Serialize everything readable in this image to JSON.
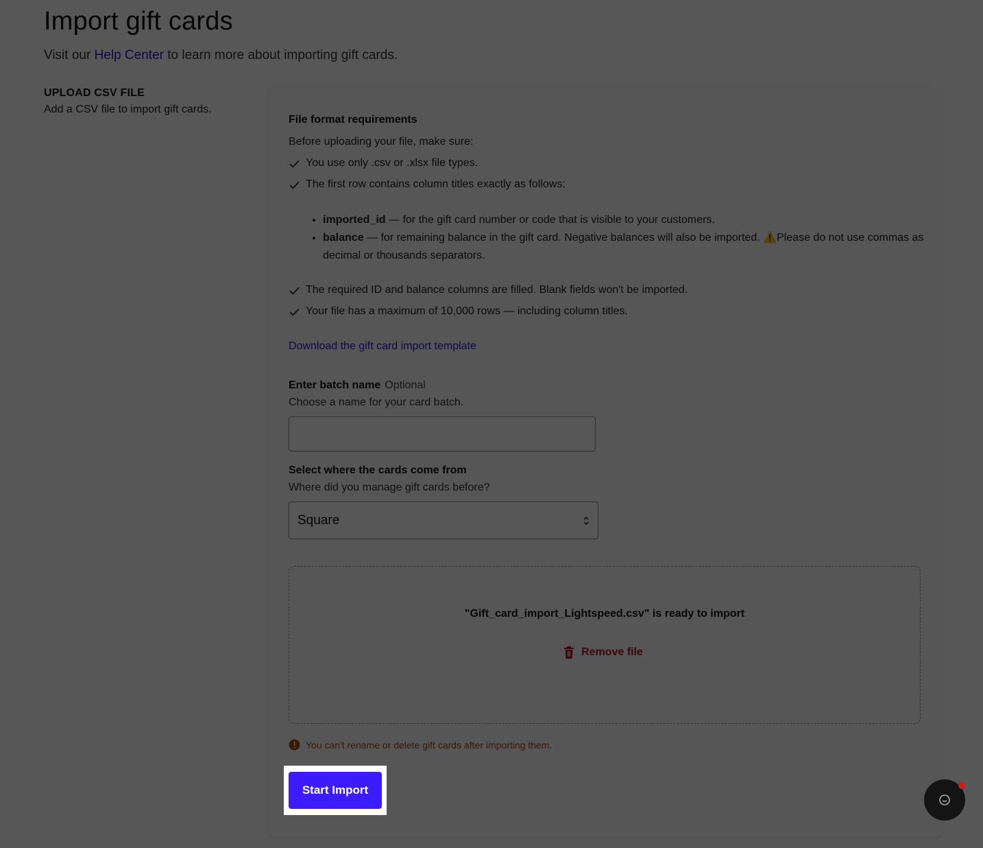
{
  "page": {
    "title": "Import gift cards",
    "subtitle_prefix": "Visit our ",
    "help_link": "Help Center",
    "subtitle_suffix": " to learn more about importing gift cards."
  },
  "section": {
    "title": "UPLOAD CSV FILE",
    "description": "Add a CSV file to import gift cards."
  },
  "requirements": {
    "title": "File format requirements",
    "intro": "Before uploading your file, make sure:",
    "checks_top": [
      "You use only .csv or .xlsx file types.",
      "The first row contains column titles exactly as follows:"
    ],
    "columns": [
      {
        "name": "imported_id",
        "desc": " — for the gift card number or code that is visible to your customers."
      },
      {
        "name": "balance",
        "desc": " — for remaining balance in the gift card. Negative balances will also be imported. ",
        "warning": "⚠️",
        "warning_text": "Please do not use commas as decimal or thousands separators."
      }
    ],
    "checks_bottom": [
      "The required ID and balance columns are filled. Blank fields won't be imported.",
      "Your file has a maximum of 10,000 rows — including column titles."
    ],
    "template_link": "Download the gift card import template"
  },
  "batch": {
    "label": "Enter batch name",
    "optional": "Optional",
    "help": "Choose a name for your card batch.",
    "value": ""
  },
  "source": {
    "label": "Select where the cards come from",
    "help": "Where did you manage gift cards before?",
    "selected": "Square"
  },
  "upload": {
    "ready_text": "\"Gift_card_import_Lightspeed.csv\" is ready to import",
    "remove_label": "Remove file"
  },
  "notice": {
    "text": "You can't rename or delete gift cards after importing them."
  },
  "actions": {
    "start_import": "Start Import"
  },
  "colors": {
    "accent": "#3c1cff",
    "link": "#2a1ad6",
    "danger": "#b1151e",
    "warning": "#a44a10"
  }
}
